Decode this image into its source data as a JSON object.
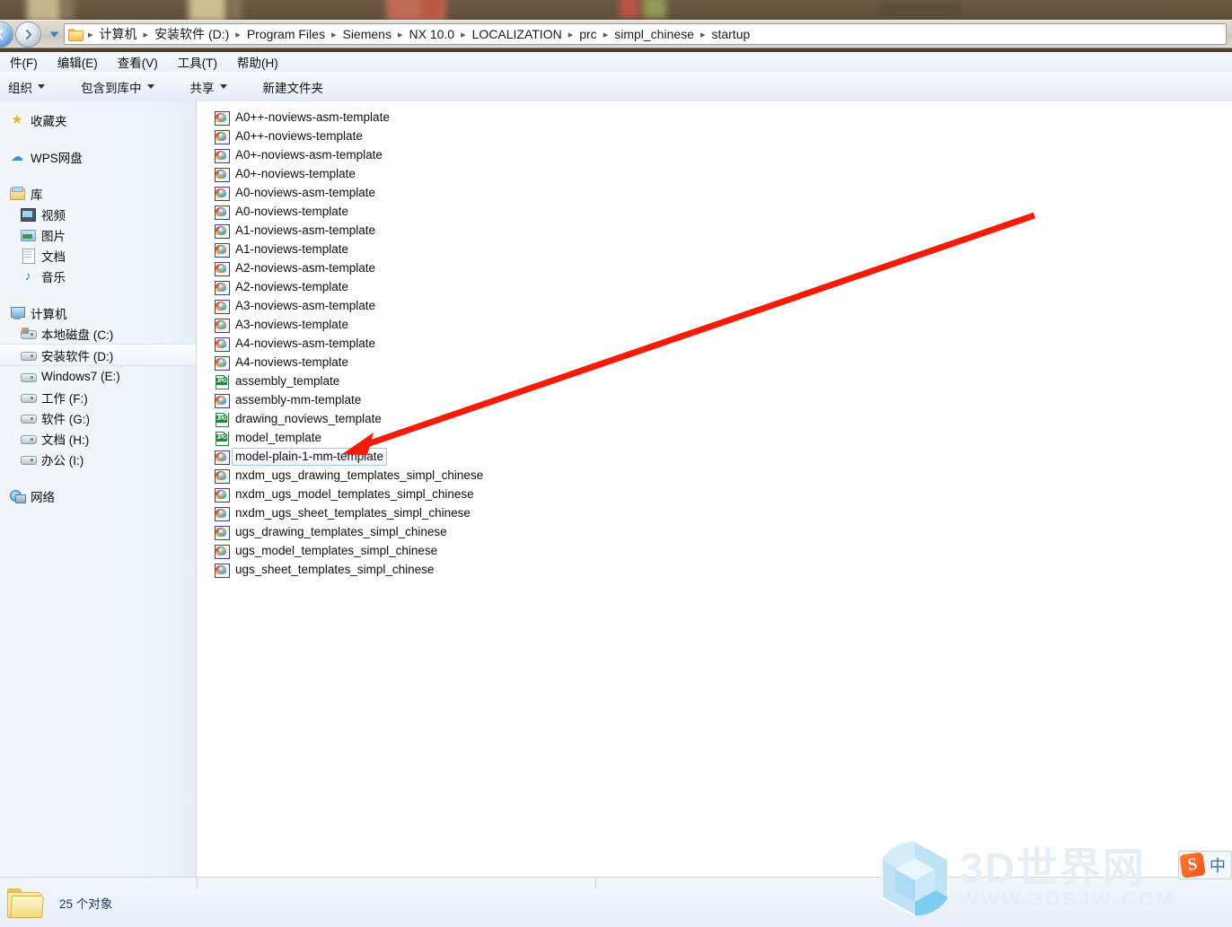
{
  "address_bar": {
    "back_icon": "back-arrow-icon",
    "forward_icon": "forward-arrow-icon",
    "history_icon": "chevron-down-icon",
    "folder_icon": "folder-icon",
    "breadcrumbs": [
      "计算机",
      "安装软件 (D:)",
      "Program Files",
      "Siemens",
      "NX 10.0",
      "LOCALIZATION",
      "prc",
      "simpl_chinese",
      "startup"
    ],
    "separator": "▸"
  },
  "menubar": {
    "items": [
      "件(F)",
      "编辑(E)",
      "查看(V)",
      "工具(T)",
      "帮助(H)"
    ]
  },
  "toolbar": {
    "items": [
      {
        "label": "组织",
        "has_caret": true
      },
      {
        "label": "包含到库中",
        "has_caret": true
      },
      {
        "label": "共享",
        "has_caret": true
      },
      {
        "label": "新建文件夹",
        "has_caret": false
      }
    ]
  },
  "sidebar": {
    "groups": [
      {
        "rows": [
          {
            "label": "收藏夹",
            "icon": "star-icon",
            "level": "root",
            "selected": false
          }
        ]
      },
      {
        "rows": [
          {
            "label": "WPS网盘",
            "icon": "cloud-icon",
            "level": "root",
            "selected": false
          }
        ]
      },
      {
        "rows": [
          {
            "label": "库",
            "icon": "library-icon",
            "level": "root",
            "selected": false
          },
          {
            "label": "视频",
            "icon": "video-icon",
            "level": "child",
            "selected": false
          },
          {
            "label": "图片",
            "icon": "picture-icon",
            "level": "child",
            "selected": false
          },
          {
            "label": "文档",
            "icon": "document-icon",
            "level": "child",
            "selected": false
          },
          {
            "label": "音乐",
            "icon": "music-icon",
            "level": "child",
            "selected": false
          }
        ]
      },
      {
        "rows": [
          {
            "label": "计算机",
            "icon": "computer-icon",
            "level": "root",
            "selected": false
          },
          {
            "label": "本地磁盘 (C:)",
            "icon": "system-drive-icon",
            "level": "child",
            "selected": false
          },
          {
            "label": "安装软件 (D:)",
            "icon": "drive-icon",
            "level": "child",
            "selected": true
          },
          {
            "label": "Windows7 (E:)",
            "icon": "drive-icon",
            "level": "child",
            "selected": false
          },
          {
            "label": "工作 (F:)",
            "icon": "drive-icon",
            "level": "child",
            "selected": false
          },
          {
            "label": "软件 (G:)",
            "icon": "drive-icon",
            "level": "child",
            "selected": false
          },
          {
            "label": "文档 (H:)",
            "icon": "drive-icon",
            "level": "child",
            "selected": false
          },
          {
            "label": "办公 (I:)",
            "icon": "drive-icon",
            "level": "child",
            "selected": false
          }
        ]
      },
      {
        "rows": [
          {
            "label": "网络",
            "icon": "network-icon",
            "level": "root",
            "selected": false
          }
        ]
      }
    ]
  },
  "file_list": {
    "files": [
      {
        "name": "A0++-noviews-asm-template",
        "icon": "nx-part-icon",
        "selected": false
      },
      {
        "name": "A0++-noviews-template",
        "icon": "nx-part-icon",
        "selected": false
      },
      {
        "name": "A0+-noviews-asm-template",
        "icon": "nx-part-icon",
        "selected": false
      },
      {
        "name": "A0+-noviews-template",
        "icon": "nx-part-icon",
        "selected": false
      },
      {
        "name": "A0-noviews-asm-template",
        "icon": "nx-part-icon",
        "selected": false
      },
      {
        "name": "A0-noviews-template",
        "icon": "nx-part-icon",
        "selected": false
      },
      {
        "name": "A1-noviews-asm-template",
        "icon": "nx-part-icon",
        "selected": false
      },
      {
        "name": "A1-noviews-template",
        "icon": "nx-part-icon",
        "selected": false
      },
      {
        "name": "A2-noviews-asm-template",
        "icon": "nx-part-icon",
        "selected": false
      },
      {
        "name": "A2-noviews-template",
        "icon": "nx-part-icon",
        "selected": false
      },
      {
        "name": "A3-noviews-asm-template",
        "icon": "nx-part-icon",
        "selected": false
      },
      {
        "name": "A3-noviews-template",
        "icon": "nx-part-icon",
        "selected": false
      },
      {
        "name": "A4-noviews-asm-template",
        "icon": "nx-part-icon",
        "selected": false
      },
      {
        "name": "A4-noviews-template",
        "icon": "nx-part-icon",
        "selected": false
      },
      {
        "name": "assembly_template",
        "icon": "jpg-image-icon",
        "selected": false
      },
      {
        "name": "assembly-mm-template",
        "icon": "nx-part-icon",
        "selected": false
      },
      {
        "name": "drawing_noviews_template",
        "icon": "jpg-image-icon",
        "selected": false
      },
      {
        "name": "model_template",
        "icon": "jpg-image-icon",
        "selected": false
      },
      {
        "name": "model-plain-1-mm-template",
        "icon": "nx-part-icon",
        "selected": true
      },
      {
        "name": "nxdm_ugs_drawing_templates_simpl_chinese",
        "icon": "nx-part-icon",
        "selected": false
      },
      {
        "name": "nxdm_ugs_model_templates_simpl_chinese",
        "icon": "nx-part-icon",
        "selected": false
      },
      {
        "name": "nxdm_ugs_sheet_templates_simpl_chinese",
        "icon": "nx-part-icon",
        "selected": false
      },
      {
        "name": "ugs_drawing_templates_simpl_chinese",
        "icon": "nx-part-icon",
        "selected": false
      },
      {
        "name": "ugs_model_templates_simpl_chinese",
        "icon": "nx-part-icon",
        "selected": false
      },
      {
        "name": "ugs_sheet_templates_simpl_chinese",
        "icon": "nx-part-icon",
        "selected": false
      }
    ],
    "jpg_label": "JPG"
  },
  "statusbar": {
    "folder_icon": "folder-icon",
    "item_count": "25 个对象"
  },
  "annotation": {
    "arrow_color": "#f61b07",
    "arrow_name": "red-pointer-arrow"
  },
  "watermark": {
    "title": "3D世界网",
    "url": "WWW.3DSJW.COM",
    "logo_icon": "hexagon-cube-logo-icon"
  },
  "ime": {
    "logo": "S",
    "mode": "中"
  }
}
